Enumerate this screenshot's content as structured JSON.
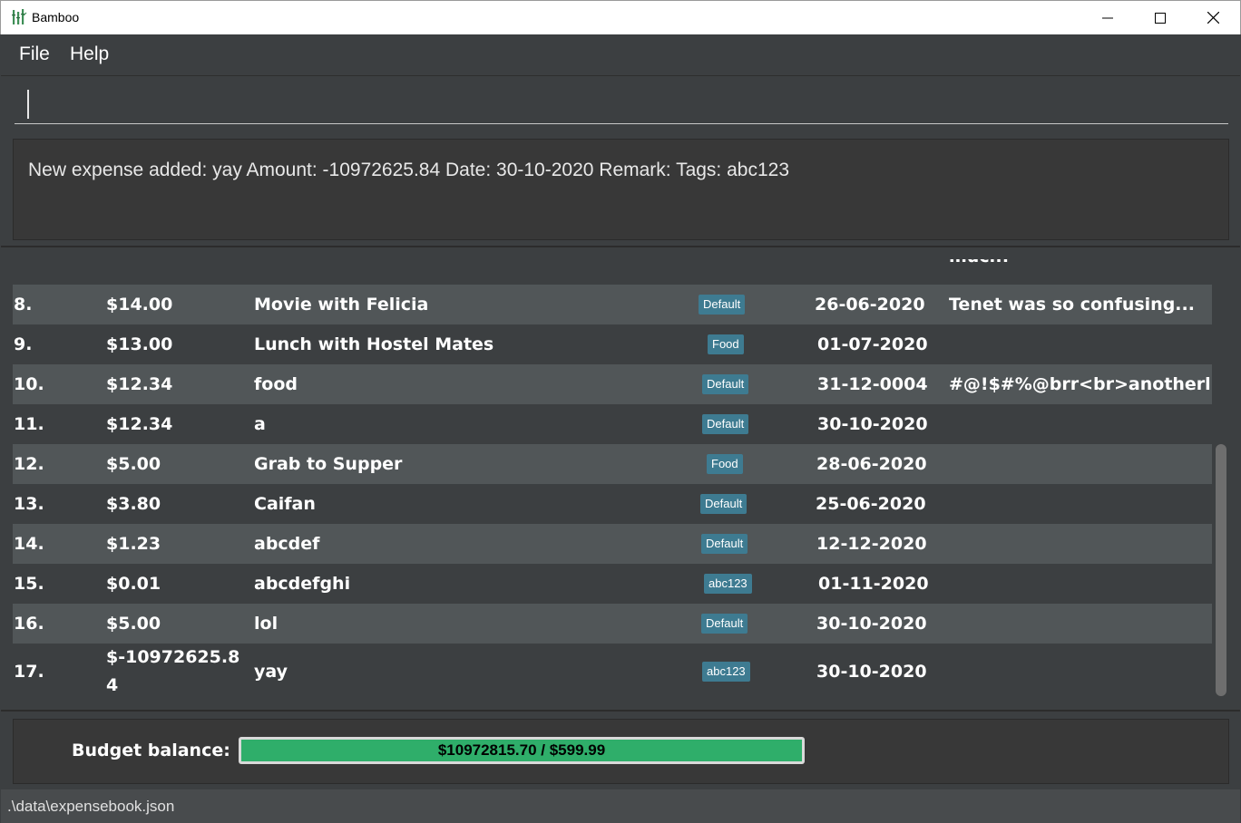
{
  "window": {
    "title": "Bamboo"
  },
  "menu": {
    "file": "File",
    "help": "Help"
  },
  "command": {
    "value": "",
    "placeholder": ""
  },
  "result": {
    "text": "New expense added: yay Amount: -10972625.84 Date: 30-10-2020 Remark:  Tags: abc123"
  },
  "expenses": {
    "partial_remark": "much!",
    "rows": [
      {
        "index": "8.",
        "amount": "$14.00",
        "description": "Movie with Felicia",
        "tag": "Default",
        "date": "26-06-2020",
        "remark": "Tenet was so confusing..."
      },
      {
        "index": "9.",
        "amount": "$13.00",
        "description": "Lunch with Hostel Mates",
        "tag": "Food",
        "date": "01-07-2020",
        "remark": ""
      },
      {
        "index": "10.",
        "amount": "$12.34",
        "description": "food",
        "tag": "Default",
        "date": "31-12-0004",
        "remark": "#@!$#%@brr<br>anotherline"
      },
      {
        "index": "11.",
        "amount": "$12.34",
        "description": "a",
        "tag": "Default",
        "date": "30-10-2020",
        "remark": ""
      },
      {
        "index": "12.",
        "amount": "$5.00",
        "description": "Grab to Supper",
        "tag": "Food",
        "date": "28-06-2020",
        "remark": ""
      },
      {
        "index": "13.",
        "amount": "$3.80",
        "description": "Caifan",
        "tag": "Default",
        "date": "25-06-2020",
        "remark": ""
      },
      {
        "index": "14.",
        "amount": "$1.23",
        "description": "abcdef",
        "tag": "Default",
        "date": "12-12-2020",
        "remark": ""
      },
      {
        "index": "15.",
        "amount": "$0.01",
        "description": "abcdefghi",
        "tag": "abc123",
        "date": "01-11-2020",
        "remark": ""
      },
      {
        "index": "16.",
        "amount": "$5.00",
        "description": "lol",
        "tag": "Default",
        "date": "30-10-2020",
        "remark": ""
      },
      {
        "index": "17.",
        "amount_line1": "$-10972625.8",
        "amount_line2": "4",
        "description": "yay",
        "tag": "abc123",
        "date": "30-10-2020",
        "remark": ""
      }
    ]
  },
  "budget": {
    "label": "Budget balance:",
    "value_text": "$10972815.70 / $599.99",
    "fill_fraction": 1.0
  },
  "status": {
    "path": ".\\data\\expensebook.json"
  },
  "colors": {
    "background": "#3c3f41",
    "row_alt": "#515658",
    "tag": "#3e7b91",
    "budget_fill": "#2fae6a"
  },
  "icons": {
    "app": "bamboo-icon",
    "minimize": "minimize-icon",
    "maximize": "maximize-icon",
    "close": "close-icon"
  }
}
